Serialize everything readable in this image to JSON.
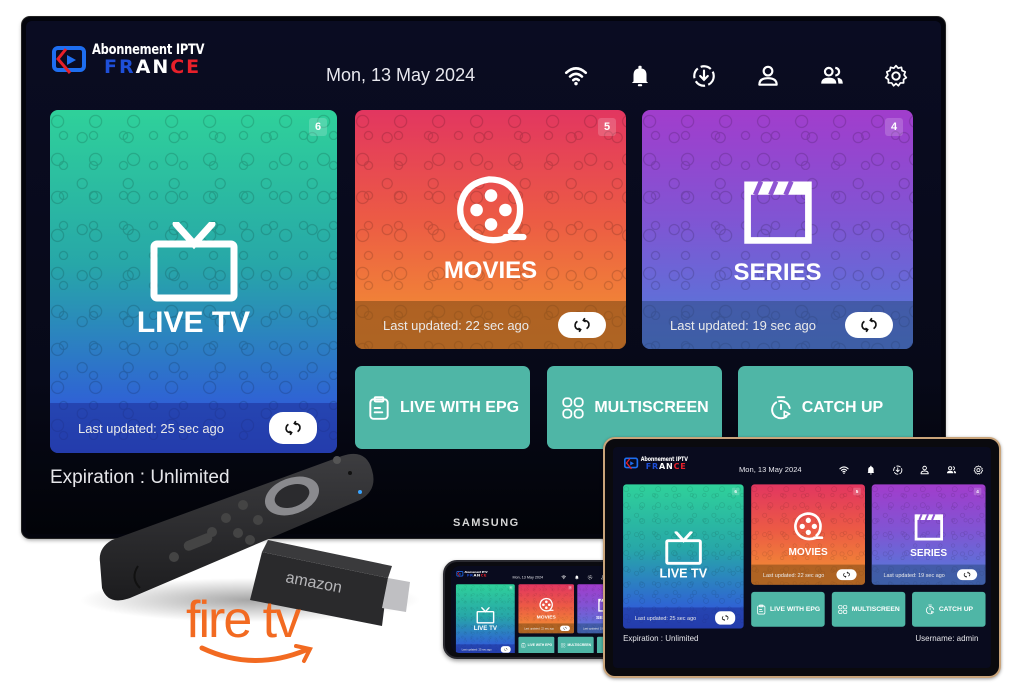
{
  "app": {
    "logo": {
      "line1": "Abonnement IPTV",
      "line2": [
        "FR",
        "AN",
        "CE"
      ]
    },
    "date": "Mon, 13 May 2024",
    "top_icons": [
      "wifi-icon",
      "bell-icon",
      "download-icon",
      "user-icon",
      "users-icon",
      "settings-icon"
    ],
    "cards": [
      {
        "id": "live-tv",
        "title": "LIVE TV",
        "badge": "6",
        "updated": "Last updated: 25 sec ago",
        "icon": "tv-icon"
      },
      {
        "id": "movies",
        "title": "MOVIES",
        "badge": "5",
        "updated": "Last updated: 22 sec ago",
        "icon": "film-reel-icon"
      },
      {
        "id": "series",
        "title": "SERIES",
        "badge": "4",
        "updated": "Last updated: 19 sec ago",
        "icon": "clapperboard-icon"
      }
    ],
    "tiles": [
      {
        "id": "live-with-epg",
        "label": "LIVE WITH EPG",
        "icon": "clipboard-icon"
      },
      {
        "id": "multiscreen",
        "label": "MULTISCREEN",
        "icon": "grid-icon"
      },
      {
        "id": "catch-up",
        "label": "CATCH UP",
        "icon": "stopwatch-icon"
      }
    ],
    "expiration": "Expiration :  Unlimited",
    "username": "Username: admin"
  },
  "devices": {
    "tv_brand": "SAMSUNG",
    "stick_brand": "amazon",
    "firetv_logo": "fire tv"
  },
  "colors": {
    "tile": "#4fb6a6",
    "logo_blue": "#1e4fd8",
    "logo_red": "#e8202a",
    "firetv_orange": "#f26a21"
  }
}
